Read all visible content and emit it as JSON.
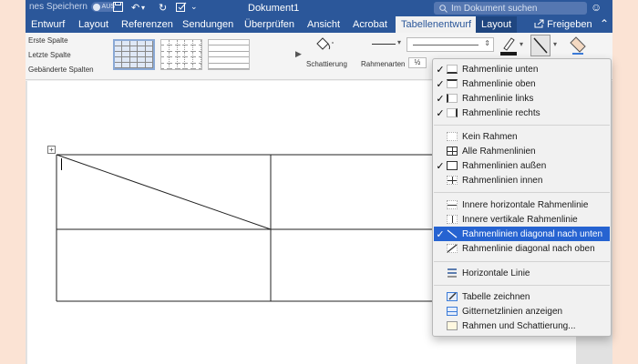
{
  "titlebar": {
    "autosave_label": "nes Speichern",
    "autosave_state": "AUS",
    "doc_title": "Dokument1",
    "search_placeholder": "Im Dokument suchen"
  },
  "tabs": [
    "Entwurf",
    "Layout",
    "Referenzen",
    "Sendungen",
    "Überprüfen",
    "Ansicht",
    "Acrobat",
    "Tabellenentwurf",
    "Layout"
  ],
  "active_tab_index": 7,
  "share_label": "Freigeben",
  "ribbon": {
    "options": [
      "Erste Spalte",
      "Letzte Spalte",
      "Gebänderte Spalten"
    ],
    "shading_label": "Schattierung",
    "border_styles_label": "Rahmenarten",
    "weight_value": "½"
  },
  "menu": {
    "items": [
      {
        "label": "Rahmenlinie unten",
        "checked": true,
        "icon": "border-bottom-icon"
      },
      {
        "label": "Rahmenlinie oben",
        "checked": true,
        "icon": "border-top-icon"
      },
      {
        "label": "Rahmenlinie links",
        "checked": true,
        "icon": "border-left-icon"
      },
      {
        "label": "Rahmenlinie rechts",
        "checked": true,
        "icon": "border-right-icon"
      },
      {
        "label": "Kein Rahmen",
        "checked": false,
        "icon": "no-border-icon"
      },
      {
        "label": "Alle Rahmenlinien",
        "checked": false,
        "icon": "all-borders-icon"
      },
      {
        "label": "Rahmenlinien außen",
        "checked": true,
        "icon": "outside-borders-icon"
      },
      {
        "label": "Rahmenlinien innen",
        "checked": false,
        "icon": "inside-borders-icon"
      },
      {
        "label": "Innere horizontale Rahmenlinie",
        "checked": false,
        "icon": "inside-horizontal-border-icon"
      },
      {
        "label": "Innere vertikale Rahmenlinie",
        "checked": false,
        "icon": "inside-vertical-border-icon"
      },
      {
        "label": "Rahmenlinien diagonal nach unten",
        "checked": true,
        "icon": "diagonal-down-border-icon",
        "highlighted": true
      },
      {
        "label": "Rahmenlinie diagonal nach oben",
        "checked": false,
        "icon": "diagonal-up-border-icon"
      },
      {
        "label": "Horizontale Linie",
        "checked": false,
        "icon": "horizontal-line-icon"
      },
      {
        "label": "Tabelle zeichnen",
        "checked": false,
        "icon": "draw-table-icon"
      },
      {
        "label": "Gitternetzlinien anzeigen",
        "checked": false,
        "icon": "gridlines-icon"
      },
      {
        "label": "Rahmen und Schattierung...",
        "checked": false,
        "icon": "borders-shading-icon"
      }
    ]
  }
}
